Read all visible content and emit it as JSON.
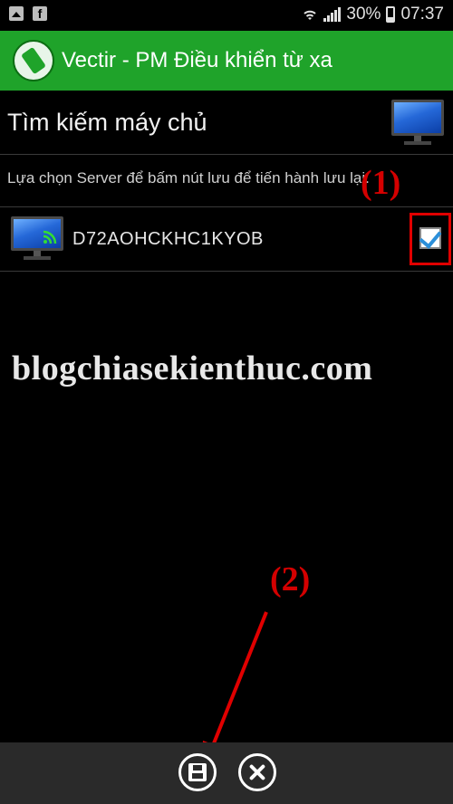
{
  "status_bar": {
    "battery": "30%",
    "time": "07:37",
    "icons": [
      "image-icon",
      "facebook-icon",
      "wifi-icon",
      "signal-icon",
      "battery-icon"
    ]
  },
  "app_bar": {
    "title": "Vectir - PM Điều khiển từ xa",
    "icon": "phone-remote-icon",
    "color": "#1fa32a"
  },
  "search": {
    "title": "Tìm kiếm máy chủ",
    "icon": "monitor-icon"
  },
  "instruction": "Lựa chọn Server để bấm nút lưu để tiến hành lưu lại.",
  "servers": [
    {
      "name": "D72AOHCKHC1KYOB",
      "checked": true,
      "icon": "monitor-wifi-icon"
    }
  ],
  "annotations": {
    "step1": "(1)",
    "step2": "(2)",
    "color": "#d40000"
  },
  "watermark": "blogchiasekienthuc.com",
  "bottom_bar": {
    "buttons": [
      "save-icon",
      "close-icon"
    ]
  }
}
